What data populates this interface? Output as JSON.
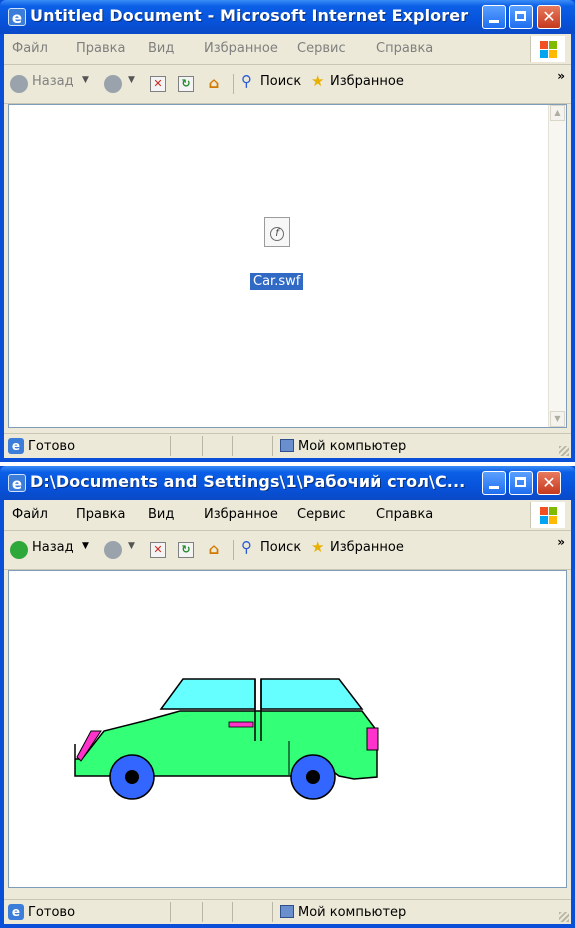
{
  "window_top": {
    "title": "Untitled Document - Microsoft Internet Explorer",
    "menu": [
      "Файл",
      "Правка",
      "Вид",
      "Избранное",
      "Сервис",
      "Справка"
    ],
    "toolbar": {
      "back": "Назад",
      "search": "Поиск",
      "favorites": "Избранное"
    },
    "file": {
      "name": "Car.swf",
      "icon": "flash-file-icon"
    },
    "status": {
      "text": "Готово",
      "zone": "Мой компьютер"
    }
  },
  "window_bottom": {
    "title": "D:\\Documents and Settings\\1\\Рабочий стол\\C...",
    "menu": [
      "Файл",
      "Правка",
      "Вид",
      "Избранное",
      "Сервис",
      "Справка"
    ],
    "toolbar": {
      "back": "Назад",
      "search": "Поиск",
      "favorites": "Избранное"
    },
    "status": {
      "text": "Готово",
      "zone": "Мой компьютер"
    },
    "car_colors": {
      "body": "#33ff77",
      "windows": "#66ffff",
      "wheels": "#3366ff",
      "lights": "#ff33cc",
      "hubs": "#000000"
    }
  }
}
